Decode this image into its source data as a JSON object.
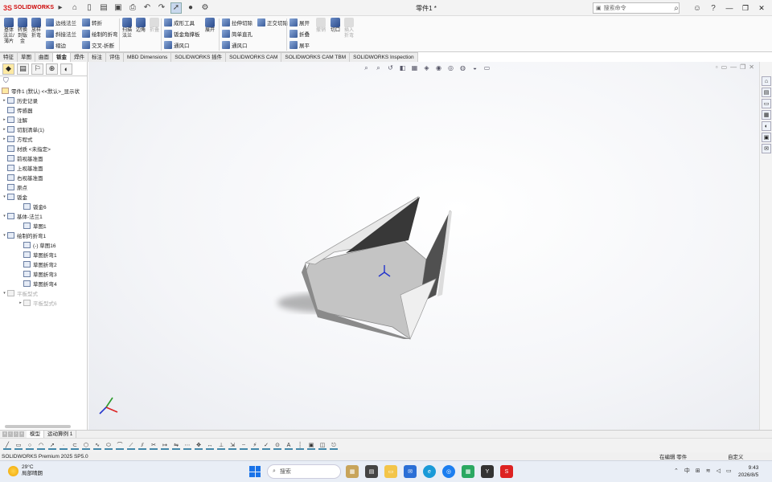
{
  "titlebar": {
    "brand_ds": "3S",
    "brand_sw": "SOLIDWORKS",
    "doc_title": "零件1 *",
    "search_placeholder": "搜索命令",
    "min": "—",
    "max": "❐",
    "close": "✕"
  },
  "ribbon": {
    "big_buttons": [
      {
        "label": "基体法兰/薄片"
      },
      {
        "label": "转换到钣金"
      },
      {
        "label": "放样折弯"
      }
    ],
    "col1": [
      "边线法兰",
      "斜接法兰",
      "褶边"
    ],
    "col2": [
      "转折",
      "绘制的折弯",
      "交叉-折断"
    ],
    "extra_big": [
      {
        "label": "扫描法兰"
      },
      {
        "label": "边角"
      },
      {
        "label": "折叠"
      },
      {
        "label": "展开"
      }
    ],
    "col3": [
      "成形工具",
      "钣金角撑板",
      "通风口"
    ],
    "col4": [
      "拉伸切除",
      "简单直孔",
      "通风口"
    ],
    "col5": [
      "正交切除"
    ],
    "col6": [
      "展开",
      "折叠",
      "展平"
    ],
    "col7": [
      "切口"
    ],
    "col8": [
      "插入折弯"
    ],
    "unfold_label": "撤销"
  },
  "tabs": [
    "特征",
    "草图",
    "曲面",
    "钣金",
    "焊件",
    "标注",
    "评估",
    "MBD Dimensions",
    "SOLIDWORKS 插件",
    "SOLIDWORKS CAM",
    "SOLIDWORKS CAM TBM",
    "SOLIDWORKS Inspection"
  ],
  "active_tab": "钣金",
  "tree": {
    "root": "零件1 (默认) <<默认>_显示状",
    "items": [
      {
        "label": "历史记录",
        "level": 1,
        "arrow": "▸"
      },
      {
        "label": "传感器",
        "level": 1,
        "arrow": ""
      },
      {
        "label": "注解",
        "level": 1,
        "arrow": "▸"
      },
      {
        "label": "切割清单(1)",
        "level": 1,
        "arrow": "▸"
      },
      {
        "label": "方程式",
        "level": 1,
        "arrow": "▸"
      },
      {
        "label": "材质 <未指定>",
        "level": 1,
        "arrow": ""
      },
      {
        "label": "前视基准面",
        "level": 1,
        "arrow": ""
      },
      {
        "label": "上视基准面",
        "level": 1,
        "arrow": ""
      },
      {
        "label": "右视基准面",
        "level": 1,
        "arrow": ""
      },
      {
        "label": "原点",
        "level": 1,
        "arrow": ""
      },
      {
        "label": "钣金",
        "level": 1,
        "arrow": "▾"
      },
      {
        "label": "钣金6",
        "level": 2,
        "arrow": ""
      },
      {
        "label": "基体-法兰1",
        "level": 1,
        "arrow": "▾"
      },
      {
        "label": "草图1",
        "level": 2,
        "arrow": ""
      },
      {
        "label": "绘制的折弯1",
        "level": 1,
        "arrow": "▾"
      },
      {
        "label": "(-) 草图16",
        "level": 2,
        "arrow": ""
      },
      {
        "label": "草图折弯1",
        "level": 2,
        "arrow": ""
      },
      {
        "label": "草图折弯2",
        "level": 2,
        "arrow": ""
      },
      {
        "label": "草图折弯3",
        "level": 2,
        "arrow": ""
      },
      {
        "label": "草图折弯4",
        "level": 2,
        "arrow": ""
      },
      {
        "label": "平板型式",
        "level": 1,
        "arrow": "▾",
        "dim": true
      },
      {
        "label": "平板型式6",
        "level": 2,
        "arrow": "▸",
        "dim": true
      }
    ]
  },
  "bottom_tabs": [
    "模型",
    "运动算例 1"
  ],
  "status": {
    "version": "SOLIDWORKS Premium 2025 SP5.0",
    "editing": "在编辑 零件",
    "custom": "自定义"
  },
  "taskbar": {
    "temp": "29°C",
    "weather": "局部晴朗",
    "search": "搜索",
    "ime": "中",
    "time": "9:43",
    "date": "2026/8/5"
  },
  "colors": {
    "accent": "#1a73e8",
    "solidworks_red": "#d22222",
    "ribbon_bg": "#fafafa"
  }
}
